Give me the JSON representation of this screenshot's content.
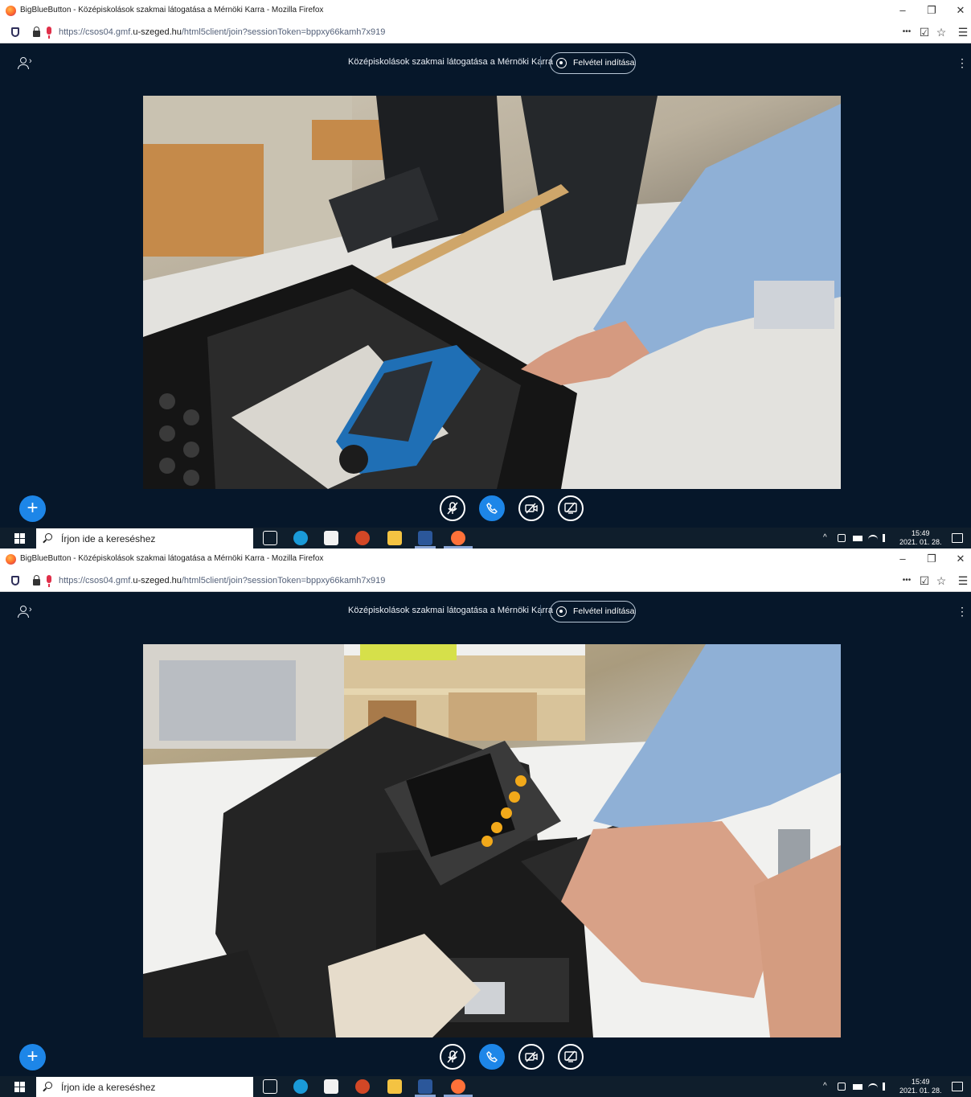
{
  "window": {
    "title": "BigBlueButton - Középiskolások szakmai látogatása a Mérnöki Karra - Mozilla Firefox",
    "min_glyph": "–",
    "max_glyph": "❐",
    "close_glyph": "✕"
  },
  "browser": {
    "url_prefix": "https://csos04.gmf.",
    "url_domain": "u-szeged.hu",
    "url_path": "/html5client/join?sessionToken=bppxy66kamh7x919",
    "menu_dots": "•••",
    "pocket_glyph": "☑",
    "star_glyph": "☆",
    "hamburger_glyph": "☰"
  },
  "meeting": {
    "title": "Középiskolások szakmai látogatása a Mérnöki Karra",
    "record_label": "Felvétel indítása",
    "user_chevron": "›",
    "kebab": "⋮",
    "plus": "+"
  },
  "taskbar": {
    "search_placeholder": "Írjon ide a kereséshez",
    "tray_chevron": "^",
    "time": "15:49",
    "date": "2021. 01. 28."
  },
  "colors": {
    "bbb_background": "#06172a",
    "accent_blue": "#1d86e8",
    "taskbar": "#0f1e2c"
  }
}
